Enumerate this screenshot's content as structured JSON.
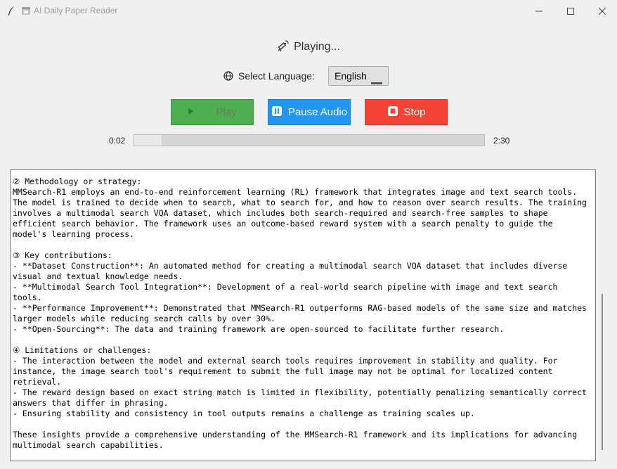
{
  "window": {
    "title": "AI Daily Paper Reader",
    "icons": {
      "app": "feather-icon",
      "title_emoji": "calendar-icon"
    }
  },
  "status": {
    "text": "Playing...",
    "icon": "satellite-icon"
  },
  "language": {
    "label": "Select Language:",
    "selected": "English",
    "icon": "globe-icon"
  },
  "buttons": {
    "play": {
      "label": "Play",
      "icon": "play-icon",
      "color": "#4caf50",
      "enabled": false
    },
    "pause": {
      "label": "Pause Audio",
      "icon": "pause-icon",
      "color": "#2196f3"
    },
    "stop": {
      "label": "Stop",
      "icon": "stop-icon",
      "color": "#f44336"
    }
  },
  "progress": {
    "current": "0:02",
    "total": "2:30",
    "fraction": 0.013
  },
  "text_lines": [
    "② Methodology or strategy:",
    "MMSearch-R1 employs an end-to-end reinforcement learning (RL) framework that integrates image and text search tools.",
    "The model is trained to decide when to search, what to search for, and how to reason over search results. The training",
    "involves a multimodal search VQA dataset, which includes both search-required and search-free samples to shape",
    "efficient search behavior. The framework uses an outcome-based reward system with a search penalty to guide the",
    "model's learning process.",
    "",
    "③ Key contributions:",
    "- **Dataset Construction**: An automated method for creating a multimodal search VQA dataset that includes diverse",
    "visual and textual knowledge needs.",
    "- **Multimodal Search Tool Integration**: Development of a real-world search pipeline with image and text search",
    "tools.",
    "- **Performance Improvement**: Demonstrated that MMSearch-R1 outperforms RAG-based models of the same size and matches",
    "larger models while reducing search calls by over 30%.",
    "- **Open-Sourcing**: The data and training framework are open-sourced to facilitate further research.",
    "",
    "④ Limitations or challenges:",
    "- The interaction between the model and external search tools requires improvement in stability and quality. For",
    "instance, the image search tool's requirement to submit the full image may not be optimal for localized content",
    "retrieval.",
    "- The reward design based on exact string match is limited in flexibility, potentially penalizing semantically correct",
    "answers that differ in phrasing.",
    "- Ensuring stability and consistency in tool outputs remains a challenge as training scales up.",
    "",
    "These insights provide a comprehensive understanding of the MMSearch-R1 framework and its implications for advancing",
    "multimodal search capabilities."
  ]
}
